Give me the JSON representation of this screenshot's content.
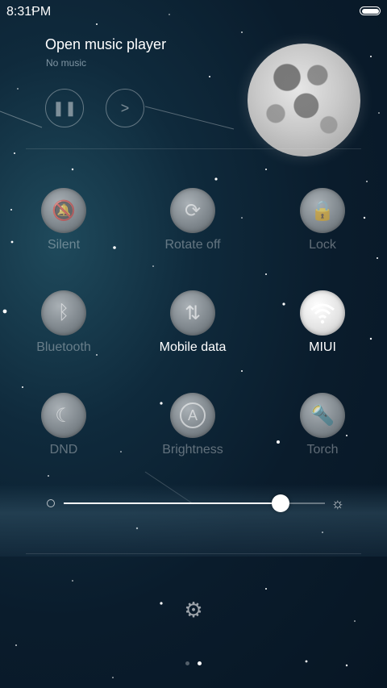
{
  "status_bar": {
    "time": "8:31PM",
    "battery": "full"
  },
  "music": {
    "title": "Open music player",
    "subtitle": "No music",
    "pause_icon": "pause-icon",
    "next_icon": "next-icon"
  },
  "toggles": [
    {
      "label": "Silent",
      "icon": "bell-off-icon",
      "on": false
    },
    {
      "label": "Rotate off",
      "icon": "rotate-lock-icon",
      "on": false
    },
    {
      "label": "Lock",
      "icon": "lock-icon",
      "on": false
    },
    {
      "label": "Bluetooth",
      "icon": "bluetooth-icon",
      "on": false
    },
    {
      "label": "Mobile data",
      "icon": "mobile-data-icon",
      "on": false
    },
    {
      "label": "MIUI",
      "icon": "wifi-icon",
      "on": true
    },
    {
      "label": "DND",
      "icon": "moon-icon",
      "on": false
    },
    {
      "label": "Brightness",
      "icon": "auto-brightness-icon",
      "on": false
    },
    {
      "label": "Torch",
      "icon": "torch-icon",
      "on": false
    }
  ],
  "brightness": {
    "level": 0.83
  },
  "settings_icon": "gear-icon",
  "pager": {
    "count": 2,
    "active": 1
  },
  "colors": {
    "background": "#0a1c2c",
    "accent": "#ffffff",
    "inactive_label": "#5a6d78"
  }
}
